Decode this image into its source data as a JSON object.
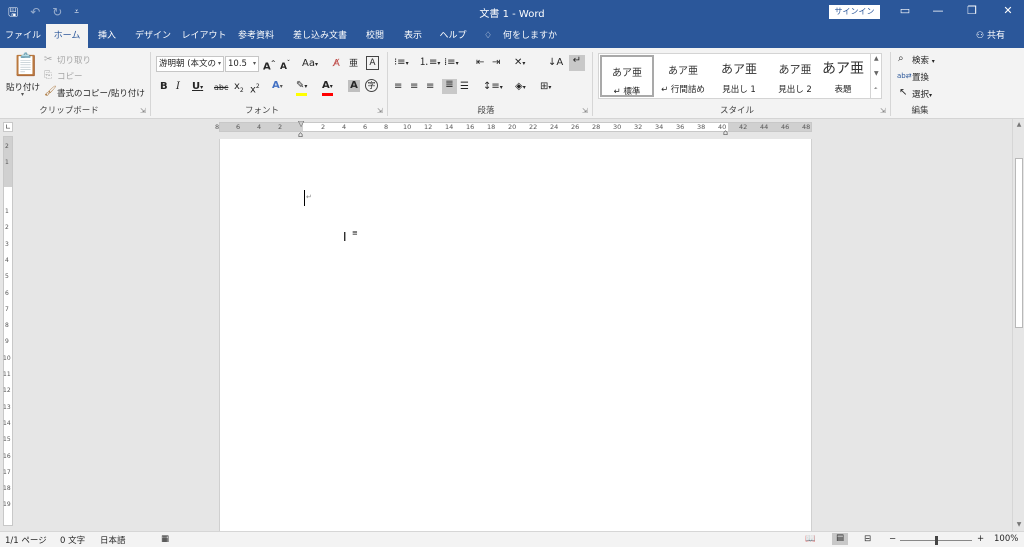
{
  "titlebar": {
    "title": "文書 1  -  Word",
    "signin": "サインイン",
    "qat_save_icon": "save-icon",
    "qat_undo_icon": "undo-icon",
    "qat_redo_icon": "redo-icon"
  },
  "tabs": [
    "ファイル",
    "ホーム",
    "挿入",
    "デザイン",
    "レイアウト",
    "参考資料",
    "差し込み文書",
    "校閲",
    "表示",
    "ヘルプ"
  ],
  "tell_me": "何をしますか",
  "share": "共有",
  "clipboard": {
    "paste": "貼り付け",
    "cut": "切り取り",
    "copy": "コピー",
    "format_painter": "書式のコピー/貼り付け",
    "label": "クリップボード"
  },
  "font": {
    "name": "游明朝 (本文の",
    "size": "10.5",
    "label": "フォント",
    "aa": "Aa"
  },
  "paragraph": {
    "label": "段落"
  },
  "styles": {
    "label": "スタイル",
    "items": [
      {
        "sample": "あア亜",
        "name": "↵ 標準"
      },
      {
        "sample": "あア亜",
        "name": "↵ 行間詰め"
      },
      {
        "sample": "あア亜",
        "name": "見出し 1"
      },
      {
        "sample": "あア亜",
        "name": "見出し 2"
      },
      {
        "sample": "あア亜",
        "name": "表題"
      }
    ]
  },
  "editing": {
    "find": "検索",
    "replace": "置換",
    "select": "選択",
    "label": "編集"
  },
  "ruler": {
    "h_left": [
      "8",
      "6",
      "4",
      "2"
    ],
    "h_right": [
      "2",
      "4",
      "6",
      "8",
      "10",
      "12",
      "14",
      "16",
      "18",
      "20",
      "22",
      "24",
      "26",
      "28",
      "30",
      "32",
      "34",
      "36",
      "38",
      "40",
      "42",
      "44",
      "46",
      "48"
    ],
    "v_top": [
      "2",
      "1"
    ],
    "v_main": [
      "1",
      "2",
      "3",
      "4",
      "5",
      "6",
      "7",
      "8",
      "9",
      "10",
      "11",
      "12",
      "13",
      "14",
      "15",
      "16",
      "17",
      "18",
      "19"
    ]
  },
  "status": {
    "page": "1/1 ページ",
    "words": "0 文字",
    "language": "日本語",
    "zoom": "100%",
    "zoom_minus": "−",
    "zoom_plus": "+"
  }
}
